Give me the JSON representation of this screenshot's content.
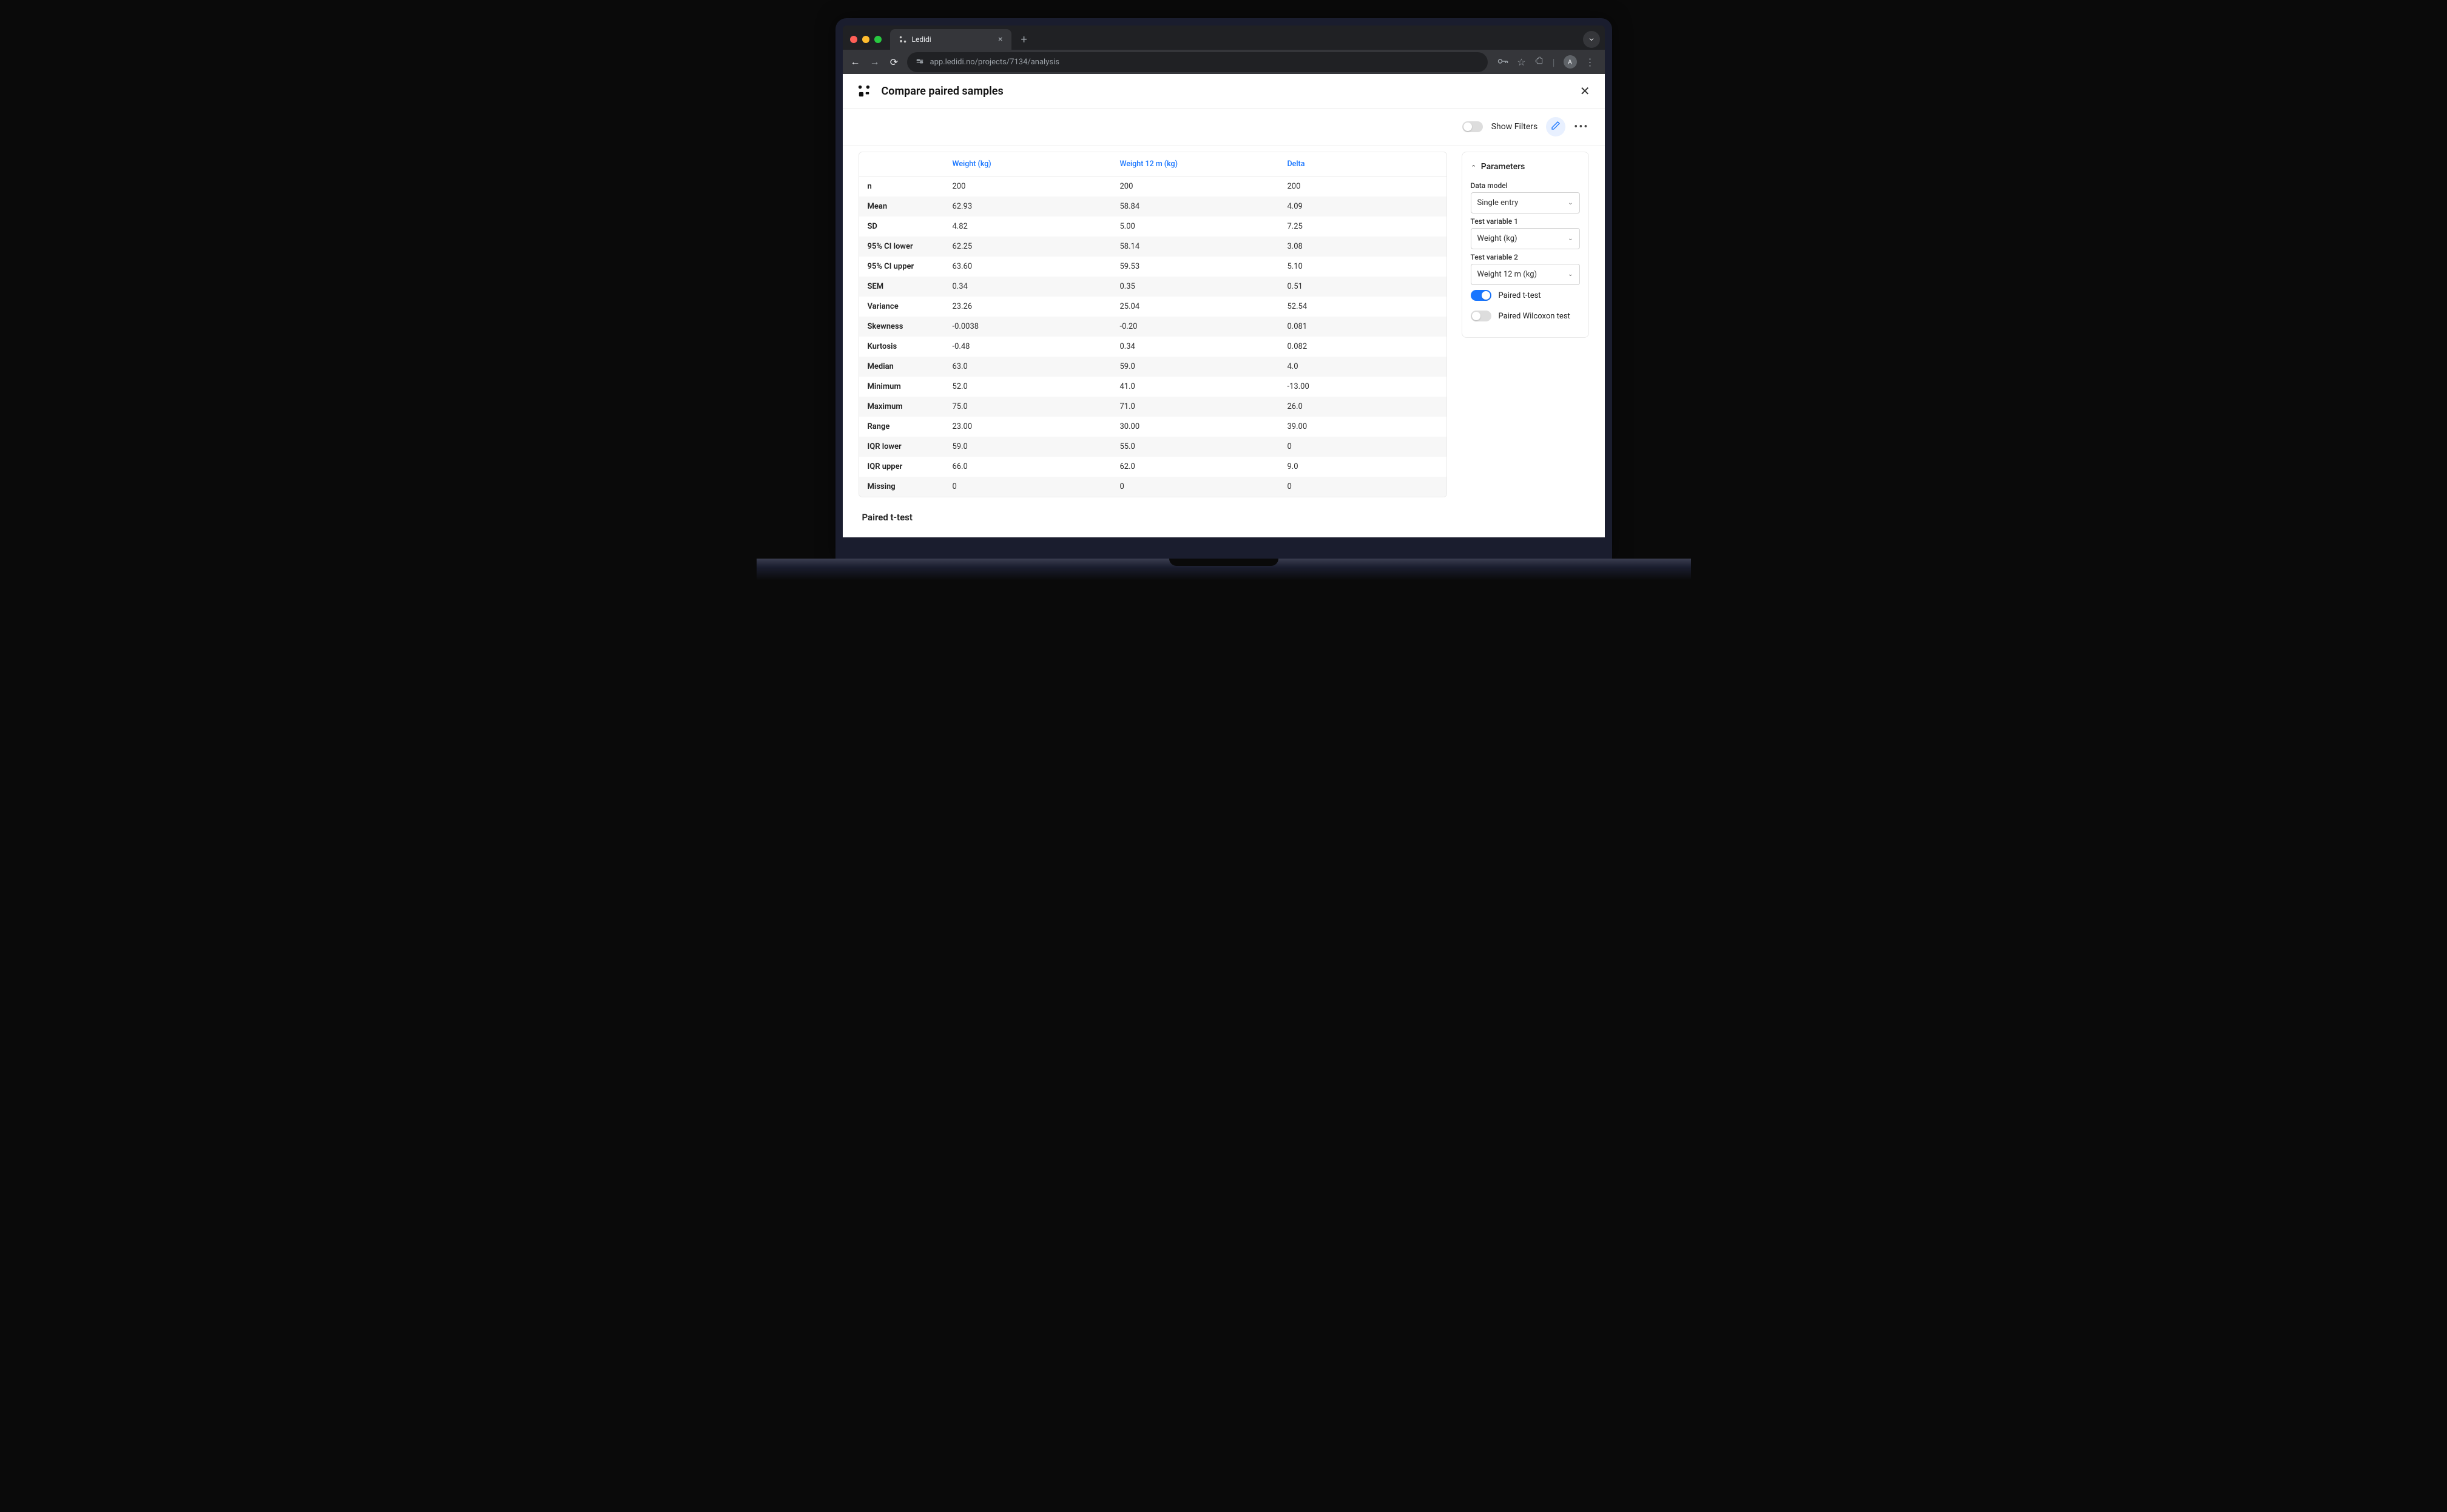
{
  "browser": {
    "tab_title": "Ledidi",
    "url": "app.ledidi.no/projects/7134/analysis",
    "avatar_letter": "A"
  },
  "header": {
    "title": "Compare paired samples"
  },
  "toolbar": {
    "show_filters_label": "Show Filters"
  },
  "table": {
    "columns": [
      "Weight (kg)",
      "Weight 12 m (kg)",
      "Delta"
    ],
    "rows": [
      {
        "label": "n",
        "v": [
          "200",
          "200",
          "200"
        ]
      },
      {
        "label": "Mean",
        "v": [
          "62.93",
          "58.84",
          "4.09"
        ]
      },
      {
        "label": "SD",
        "v": [
          "4.82",
          "5.00",
          "7.25"
        ]
      },
      {
        "label": "95% CI lower",
        "v": [
          "62.25",
          "58.14",
          "3.08"
        ]
      },
      {
        "label": "95% CI upper",
        "v": [
          "63.60",
          "59.53",
          "5.10"
        ]
      },
      {
        "label": "SEM",
        "v": [
          "0.34",
          "0.35",
          "0.51"
        ]
      },
      {
        "label": "Variance",
        "v": [
          "23.26",
          "25.04",
          "52.54"
        ]
      },
      {
        "label": "Skewness",
        "v": [
          "-0.0038",
          "-0.20",
          "0.081"
        ]
      },
      {
        "label": "Kurtosis",
        "v": [
          "-0.48",
          "0.34",
          "0.082"
        ]
      },
      {
        "label": "Median",
        "v": [
          "63.0",
          "59.0",
          "4.0"
        ]
      },
      {
        "label": "Minimum",
        "v": [
          "52.0",
          "41.0",
          "-13.00"
        ]
      },
      {
        "label": "Maximum",
        "v": [
          "75.0",
          "71.0",
          "26.0"
        ]
      },
      {
        "label": "Range",
        "v": [
          "23.00",
          "30.00",
          "39.00"
        ]
      },
      {
        "label": "IQR lower",
        "v": [
          "59.0",
          "55.0",
          "0"
        ]
      },
      {
        "label": "IQR upper",
        "v": [
          "66.0",
          "62.0",
          "9.0"
        ]
      },
      {
        "label": "Missing",
        "v": [
          "0",
          "0",
          "0"
        ]
      }
    ]
  },
  "section_below": "Paired t-test",
  "panel": {
    "title": "Parameters",
    "data_model_label": "Data model",
    "data_model_value": "Single entry",
    "var1_label": "Test variable 1",
    "var1_value": "Weight (kg)",
    "var2_label": "Test variable 2",
    "var2_value": "Weight 12 m (kg)",
    "test1": "Paired t-test",
    "test2": "Paired Wilcoxon test"
  }
}
